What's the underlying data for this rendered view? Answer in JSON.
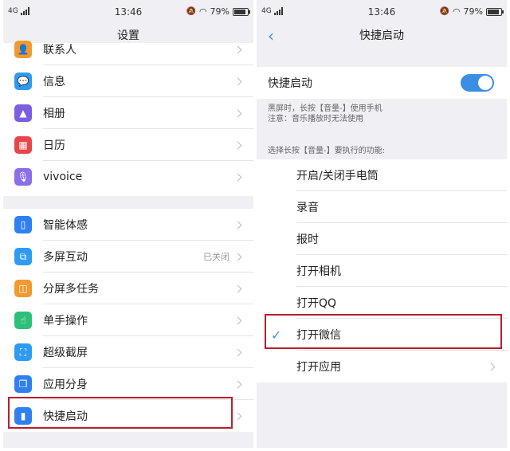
{
  "left": {
    "status": {
      "network": "4G",
      "time": "13:46",
      "battery": "79%"
    },
    "title": "设置",
    "group1": [
      {
        "label": "联系人",
        "icon": "contacts-icon",
        "color": "#f39a2e"
      },
      {
        "label": "信息",
        "icon": "message-icon",
        "color": "#2f9bf0"
      },
      {
        "label": "相册",
        "icon": "album-icon",
        "color": "#7b5fe0"
      },
      {
        "label": "日历",
        "icon": "calendar-icon",
        "color": "#e8474a"
      },
      {
        "label": "vivoice",
        "icon": "microphone-icon",
        "color": "#8a6fe8"
      }
    ],
    "group2": [
      {
        "label": "智能体感",
        "icon": "phone-motion-icon",
        "color": "#2f7ff0",
        "value": ""
      },
      {
        "label": "多屏互动",
        "icon": "multi-screen-icon",
        "color": "#2f9bf0",
        "value": "已关闭"
      },
      {
        "label": "分屏多任务",
        "icon": "split-screen-icon",
        "color": "#f39a2e",
        "value": ""
      },
      {
        "label": "单手操作",
        "icon": "one-hand-icon",
        "color": "#2ebf7a",
        "value": ""
      },
      {
        "label": "超级截屏",
        "icon": "screenshot-icon",
        "color": "#2f9bf0",
        "value": ""
      },
      {
        "label": "应用分身",
        "icon": "app-clone-icon",
        "color": "#2f7ff0",
        "value": ""
      },
      {
        "label": "快捷启动",
        "icon": "quick-launch-icon",
        "color": "#2f7ff0",
        "value": ""
      }
    ]
  },
  "right": {
    "status": {
      "network": "4G",
      "time": "13:46",
      "battery": "79%"
    },
    "title": "快捷启动",
    "toggle_label": "快捷启动",
    "hint1": "黑屏时，长按【音量-】使用手机",
    "hint2": "注意：音乐播放时无法使用",
    "section_label": "选择长按【音量-】要执行的功能:",
    "options": [
      {
        "label": "开启/关闭手电筒",
        "checked": false,
        "arrow": false
      },
      {
        "label": "录音",
        "checked": false,
        "arrow": false
      },
      {
        "label": "报时",
        "checked": false,
        "arrow": false
      },
      {
        "label": "打开相机",
        "checked": false,
        "arrow": false
      },
      {
        "label": "打开QQ",
        "checked": false,
        "arrow": false
      },
      {
        "label": "打开微信",
        "checked": true,
        "arrow": false
      },
      {
        "label": "打开应用",
        "checked": false,
        "arrow": true
      }
    ]
  },
  "colors": {
    "accent": "#3b8ee3",
    "highlight": "#b3202e"
  }
}
